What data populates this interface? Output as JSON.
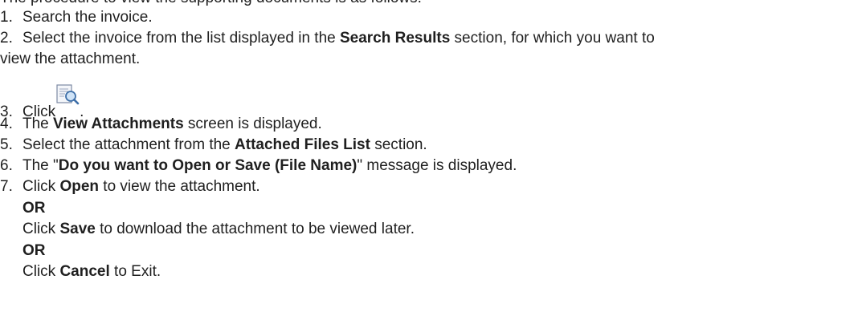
{
  "intro": "The procedure to view the supporting documents is as follows:",
  "steps": {
    "s1": {
      "num": "1.",
      "text": "Search the invoice."
    },
    "s2": {
      "num": "2.",
      "before": "Select the invoice from the list displayed in the ",
      "bold": "Search Results",
      "after": " section, for which you want to",
      "cont": "view the attachment."
    },
    "s3": {
      "num": "3.",
      "before": "Click",
      "after": ".",
      "icon": "view-attachment-icon"
    },
    "s4": {
      "num": "4.",
      "before": "The ",
      "bold": "View Attachments",
      "after": " screen is displayed."
    },
    "s5": {
      "num": "5.",
      "before": "Select the attachment from the ",
      "bold": "Attached Files List",
      "after": " section."
    },
    "s6": {
      "num": "6.",
      "before": "The \"",
      "bold": "Do you want to Open or Save (File Name)",
      "after": "\" message is displayed."
    },
    "s7": {
      "num": "7.",
      "before": "Click ",
      "bold": "Open",
      "after": " to view the attachment.",
      "or1": "OR",
      "save_before": "Click ",
      "save_bold": "Save",
      "save_after": " to download the attachment to be viewed later.",
      "or2": "OR",
      "cancel_before": "Click ",
      "cancel_bold": "Cancel",
      "cancel_after": " to Exit."
    }
  }
}
